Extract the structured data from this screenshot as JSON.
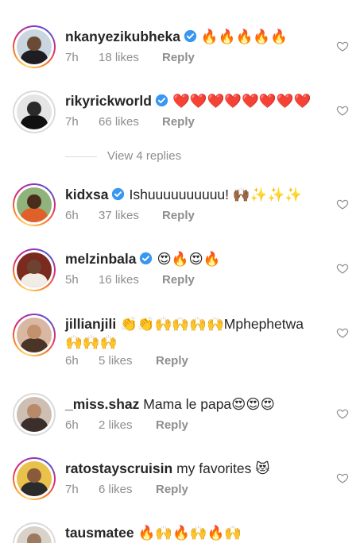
{
  "comments": [
    {
      "username": "nkanyezikubheka",
      "verified": true,
      "text": "🔥🔥🔥🔥🔥",
      "time": "7h",
      "likes": "18 likes",
      "reply": "Reply"
    },
    {
      "username": "rikyrickworld",
      "verified": true,
      "text": "❤️❤️❤️❤️❤️❤️❤️❤️",
      "time": "7h",
      "likes": "66 likes",
      "reply": "Reply"
    },
    {
      "username": "kidxsa",
      "verified": true,
      "text": "Ishuuuuuuuuuu! 🙌🏾✨✨✨",
      "time": "6h",
      "likes": "37 likes",
      "reply": "Reply"
    },
    {
      "username": "melzinbala",
      "verified": true,
      "text": "😍🔥😍🔥",
      "time": "5h",
      "likes": "16 likes",
      "reply": "Reply"
    },
    {
      "username": "jillianjili",
      "verified": false,
      "text": "👏👏🙌🙌🙌🙌Mphephetwa 🙌🙌🙌",
      "time": "6h",
      "likes": "5 likes",
      "reply": "Reply"
    },
    {
      "username": "_miss.shaz",
      "verified": false,
      "text": "Mama le papa😍😍😍",
      "time": "6h",
      "likes": "2 likes",
      "reply": "Reply"
    },
    {
      "username": "ratostayscruisin",
      "verified": false,
      "text": "my favorites 😻",
      "time": "7h",
      "likes": "6 likes",
      "reply": "Reply"
    },
    {
      "username": "tausmatee",
      "verified": false,
      "text": "🔥🙌🔥🙌🔥🙌",
      "time": "",
      "likes": "",
      "reply": ""
    }
  ],
  "view_replies": "View 4 replies",
  "colors": {
    "verified": "#3897f0",
    "meta": "#8e8e8e",
    "text": "#262626"
  }
}
